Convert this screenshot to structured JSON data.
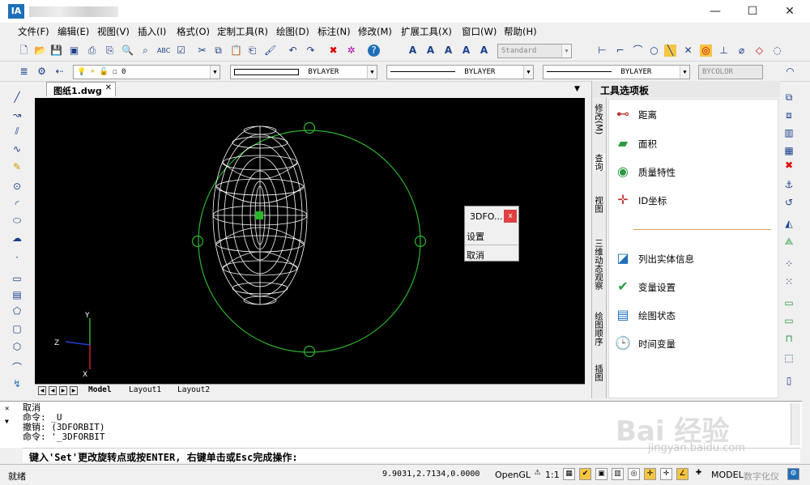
{
  "window": {
    "app_icon": "IA",
    "minimize": "—",
    "maximize": "☐",
    "close": "✕"
  },
  "menu": [
    "文件(F)",
    "编辑(E)",
    "视图(V)",
    "插入(I)",
    "格式(O)",
    "定制工具(R)",
    "绘图(D)",
    "标注(N)",
    "修改(M)",
    "扩展工具(X)",
    "窗口(W)",
    "帮助(H)"
  ],
  "toolbar": {
    "text_style": "Standard",
    "layer": "0",
    "color": "BYLAYER",
    "linetype": "BYLAYER",
    "lineweight": "BYLAYER",
    "plot_style": "BYCOLOR"
  },
  "document_tab": "图纸1.dwg",
  "layout_tabs": [
    "Model",
    "Layout1",
    "Layout2"
  ],
  "ucs": {
    "x": "X",
    "y": "Y",
    "z": "Z"
  },
  "popup": {
    "title": "3DFO...",
    "close": "x",
    "items": [
      "设置",
      "取消"
    ]
  },
  "palette": {
    "title": "工具选项板",
    "vtabs": [
      "修改(M)",
      "查询",
      "视图",
      "三维动态观察",
      "绘图顺序",
      "插图"
    ],
    "items_top": [
      {
        "label": "距离",
        "icon": "distance-icon"
      },
      {
        "label": "面积",
        "icon": "area-icon"
      },
      {
        "label": "质量特性",
        "icon": "mass-properties-icon"
      },
      {
        "label": "ID坐标",
        "icon": "id-point-icon"
      }
    ],
    "items_bottom": [
      {
        "label": "列出实体信息",
        "icon": "list-info-icon"
      },
      {
        "label": "变量设置",
        "icon": "variable-settings-icon"
      },
      {
        "label": "绘图状态",
        "icon": "drawing-status-icon"
      },
      {
        "label": "时间变量",
        "icon": "time-variable-icon"
      }
    ]
  },
  "command": {
    "lines": [
      "取消",
      "命令: _U",
      "撤销: (3DFORBIT)",
      "命令: '_3DFORBIT"
    ],
    "prompt": "键入'Set'更改旋转点或按ENTER, 右键单击或Esc完成操作:"
  },
  "status": {
    "ready": "就绪",
    "coords": "9.9031,2.7134,0.0000",
    "opengl": "OpenGL",
    "scale": "1:1",
    "model": "MODEL",
    "digital": "数字化仪"
  },
  "watermark": {
    "brand": "Bai 经验",
    "url": "jingyan.baidu.com"
  },
  "colors": {
    "canvas": "#000000",
    "wire": "#ffffff",
    "orbit": "#2bb52b",
    "close_red": "#e04040"
  }
}
